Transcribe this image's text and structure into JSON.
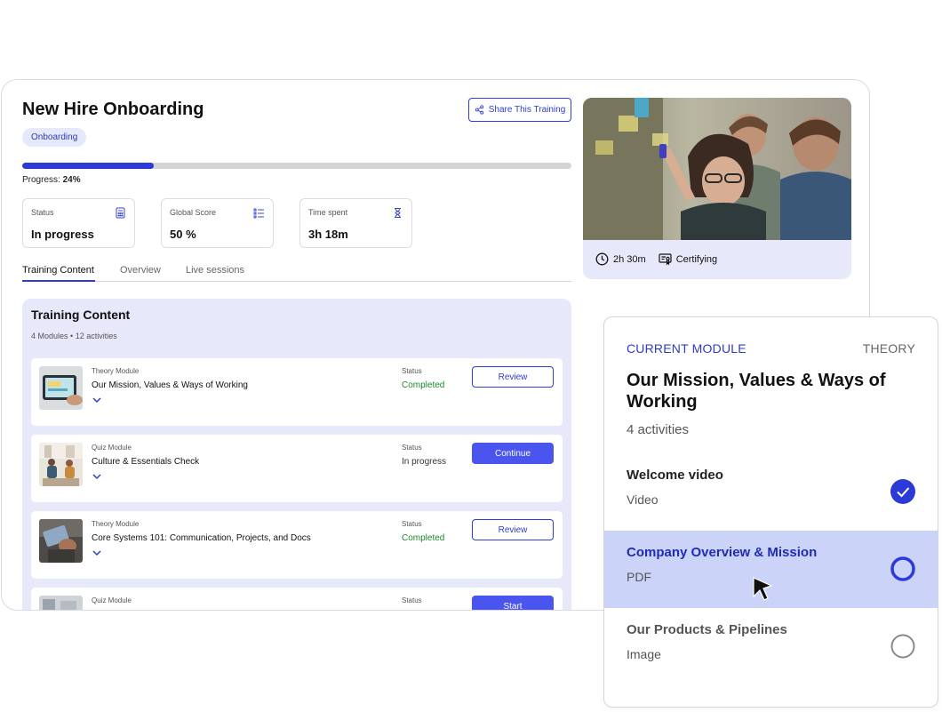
{
  "training": {
    "title": "New Hire Onboarding",
    "tag": "Onboarding",
    "share_label": "Share This Training",
    "progress_label": "Progress:",
    "progress_value": "24%",
    "progress_fraction": 0.24
  },
  "stats": [
    {
      "label": "Status",
      "value": "In progress",
      "icon": "calculator-icon"
    },
    {
      "label": "Global Score",
      "value": "50 %",
      "icon": "list-icon"
    },
    {
      "label": "Time spent",
      "value": "3h 18m",
      "icon": "hourglass-icon"
    }
  ],
  "tabs": [
    "Training Content",
    "Overview",
    "Live sessions"
  ],
  "content": {
    "title": "Training Content",
    "modules_count": "4 Modules",
    "activities_count": "12 activities",
    "status_label": "Status",
    "modules": [
      {
        "type": "Theory Module",
        "name": "Our Mission, Values & Ways of Working",
        "status": "Completed",
        "button": "Review"
      },
      {
        "type": "Quiz Module",
        "name": "Culture & Essentials Check",
        "status": "In progress",
        "button": "Continue"
      },
      {
        "type": "Theory Module",
        "name": "Core Systems 101: Communication, Projects, and Docs",
        "status": "Completed",
        "button": "Review"
      },
      {
        "type": "Quiz Module",
        "name": "",
        "status": "",
        "button": "Start"
      }
    ]
  },
  "hero": {
    "duration": "2h 30m",
    "certification": "Certifying"
  },
  "current_module": {
    "label": "CURRENT MODULE",
    "type": "THEORY",
    "title": "Our Mission, Values & Ways of Working",
    "activities": "4 activities",
    "items": [
      {
        "name": "Welcome video",
        "kind": "Video",
        "state": "done"
      },
      {
        "name": "Company Overview & Mission",
        "kind": "PDF",
        "state": "active"
      },
      {
        "name": "Our Products & Pipelines",
        "kind": "Image",
        "state": "todo"
      }
    ]
  },
  "colors": {
    "accent": "#2c3ad6",
    "completed": "#1b8a2a",
    "panel_bg": "#e7e9fb",
    "active_row": "#cbd3f9"
  }
}
